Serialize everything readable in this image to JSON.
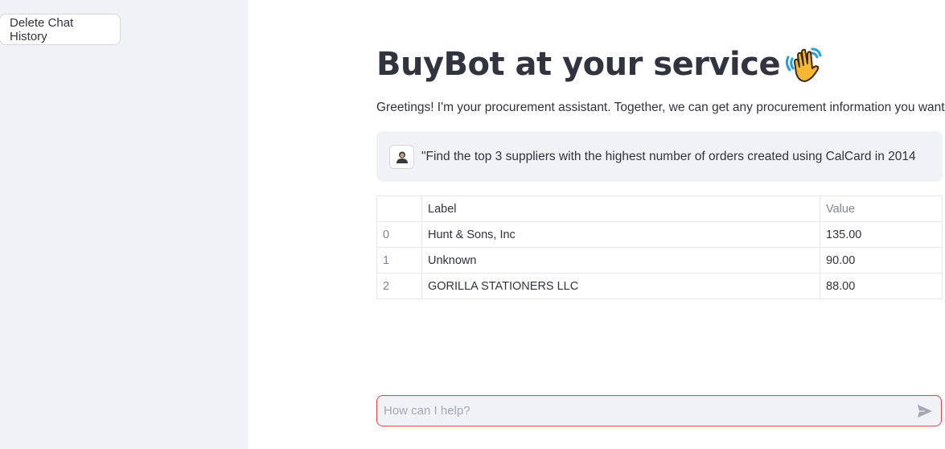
{
  "sidebar": {
    "delete_button_label": "Delete Chat History"
  },
  "main": {
    "title": "BuyBot at your service",
    "title_icon": "waving-hand-icon",
    "greeting": "Greetings! I'm your procurement assistant. Together, we can get any procurement information you want.",
    "user_message": {
      "avatar_icon": "user-avatar-icon",
      "text": "\"Find the top 3 suppliers with the highest number of orders created using CalCard in 2014"
    },
    "table": {
      "columns": [
        "",
        "Label",
        "Value"
      ],
      "rows": [
        {
          "index": "0",
          "label": "Hunt & Sons, Inc",
          "value": "135.00"
        },
        {
          "index": "1",
          "label": "Unknown",
          "value": "90.00"
        },
        {
          "index": "2",
          "label": "GORILLA STATIONERS LLC",
          "value": "88.00"
        }
      ]
    },
    "chat_input": {
      "placeholder": "How can I help?",
      "send_icon": "send-icon"
    }
  },
  "colors": {
    "sidebar_bg": "#f0f2f6",
    "text": "#31333f",
    "input_border_focus": "#e0434d",
    "muted": "#808495"
  }
}
